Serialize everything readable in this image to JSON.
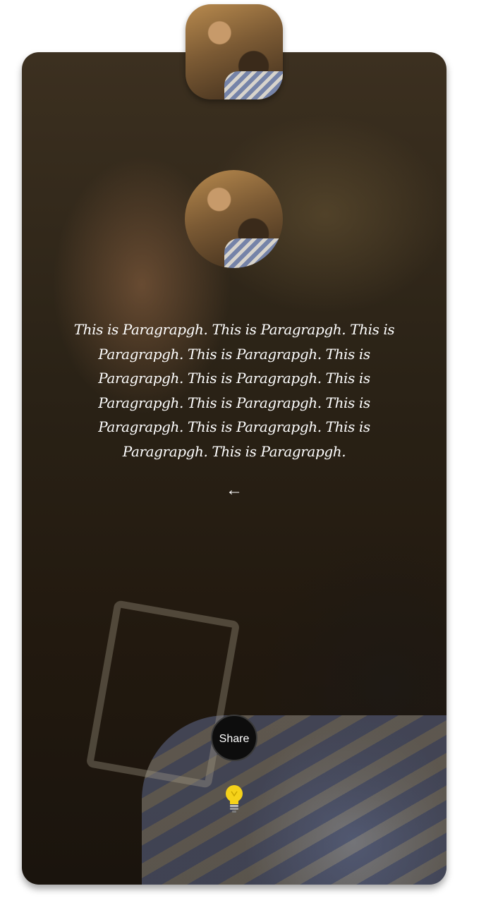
{
  "paragraph": {
    "text": "This is Paragrapgh. This is Paragrapgh. This is Paragrapgh. This is Paragrapgh. This is Paragrapgh. This is Paragrapgh. This is Paragrapgh. This is Paragrapgh. This is Paragrapgh. This is Paragrapgh. This is Paragrapgh. This is Paragrapgh."
  },
  "controls": {
    "back_icon": "←",
    "share_label": "Share"
  },
  "icons": {
    "back": "back-arrow-icon",
    "bulb": "lightbulb-icon"
  },
  "colors": {
    "text": "#ffffff",
    "share_bg": "#0d0d0d",
    "bulb": "#f5d21a"
  }
}
